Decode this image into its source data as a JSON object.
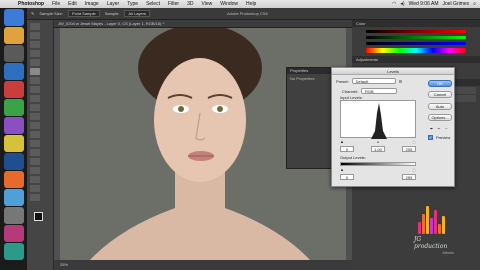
{
  "menubar": {
    "app_name": "Photoshop",
    "items": [
      "File",
      "Edit",
      "Image",
      "Layer",
      "Type",
      "Select",
      "Filter",
      "3D",
      "View",
      "Window",
      "Help"
    ],
    "clock": "Wed 9:06 AM",
    "user": "Joel Grimes"
  },
  "options_bar": {
    "sample_label": "Sample Size:",
    "sample_value": "Point Sample",
    "sample_label2": "Sample:",
    "sample_value2": "All Layers",
    "window_title": "Adobe Photoshop CS6"
  },
  "document": {
    "tab_title": "JW_0204 w Jewel Mayes - Layer 0, CS (Layer 1, RGB/16) *",
    "status": "25%"
  },
  "properties_panel": {
    "title": "Properties",
    "body": "No Properties"
  },
  "levels_dialog": {
    "title": "Levels",
    "preset_label": "Preset:",
    "preset_value": "Default",
    "channel_label": "Channel:",
    "channel_value": "RGB",
    "input_label": "Input Levels:",
    "input_black": "0",
    "input_gamma": "1.00",
    "input_white": "255",
    "output_label": "Output Levels:",
    "output_black": "0",
    "output_white": "255",
    "buttons": {
      "ok": "OK",
      "cancel": "Cancel",
      "auto": "Auto",
      "options": "Options..."
    },
    "preview_label": "Preview",
    "preview_checked": true
  },
  "logo": {
    "name": "JG production",
    "sub": "Minnix"
  },
  "colors": {
    "backdrop": "#6a6e66",
    "ok_button": "#4b8ee0"
  }
}
